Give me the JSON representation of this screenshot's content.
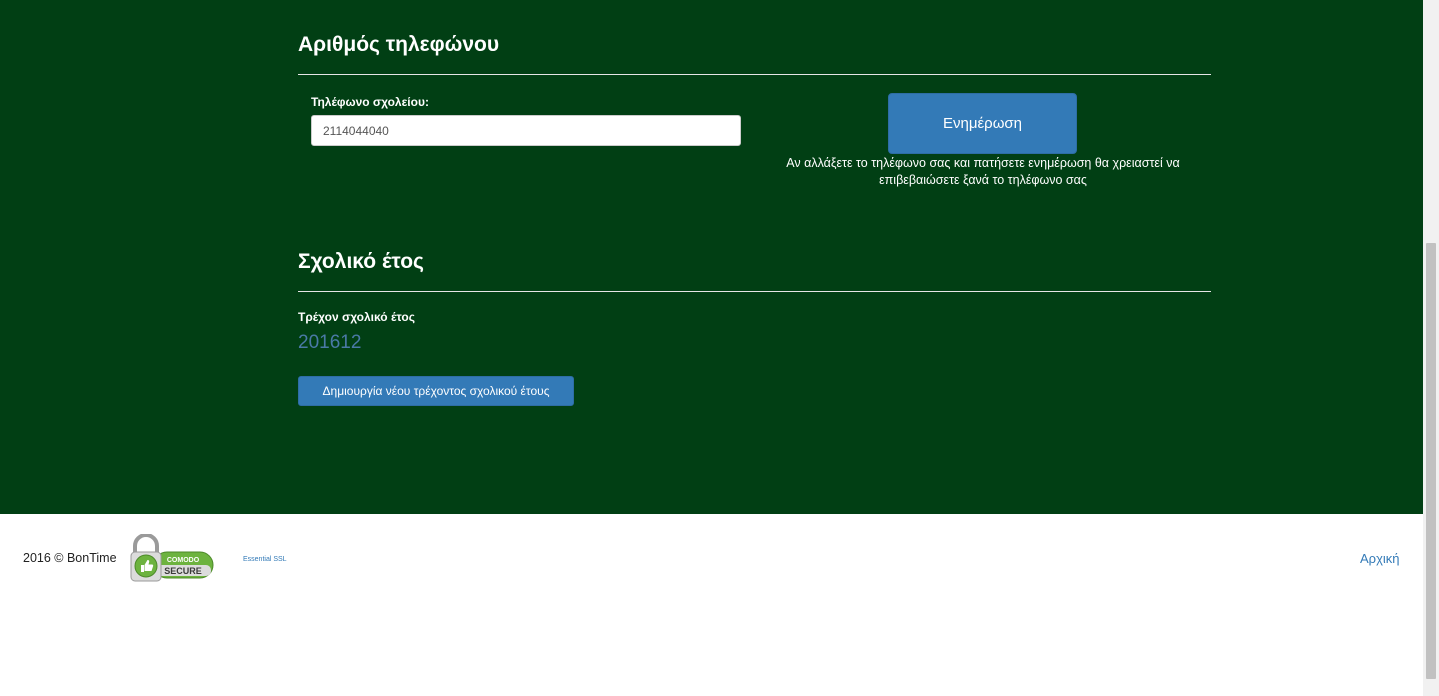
{
  "phone_section": {
    "title": "Αριθμός τηλεφώνου",
    "field_label": "Τηλέφωνο σχολείου:",
    "phone_value": "2114044040",
    "update_button": "Ενημέρωση",
    "notice": "Αν αλλάξετε το τηλέφωνο σας και πατήσετε ενημέρωση θα χρειαστεί να επιβεβαιώσετε ξανά το τηλέφωνο σας"
  },
  "school_year_section": {
    "title": "Σχολικό έτος",
    "current_label": "Τρέχον σχολικό έτος",
    "current_value": "201612",
    "new_year_button": "Δημιουργία νέου τρέχοντος σχολικού έτους"
  },
  "footer": {
    "copyright": "2016 © BonTime",
    "badge": {
      "top_text": "COMODO",
      "bottom_text": "SECURE",
      "icon": "padlock-thumbs-up-icon"
    },
    "ssl_link": "Essential SSL",
    "home_link": "Αρχική"
  },
  "colors": {
    "page_background": "#013f14",
    "primary_button": "#337ab7",
    "link": "#337ab7",
    "badge_green": "#6db33f"
  }
}
